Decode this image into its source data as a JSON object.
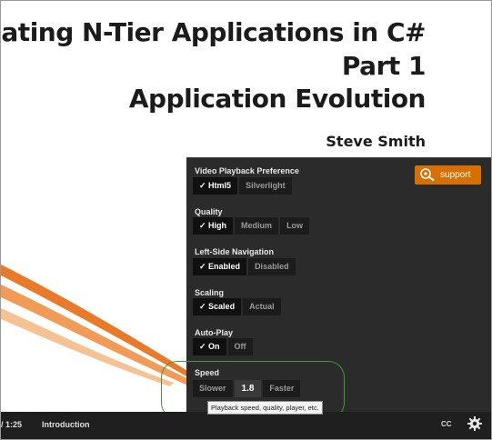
{
  "slide": {
    "title_line1": "Creating N-Tier Applications in C#",
    "title_line2": "Part 1",
    "title_line3": "Application Evolution",
    "author": "Steve Smith"
  },
  "settings_panel": {
    "support_label": "support",
    "sections": [
      {
        "label": "Video Playback Preference",
        "options": [
          "Html5",
          "Silverlight"
        ],
        "selected": "Html5"
      },
      {
        "label": "Quality",
        "options": [
          "High",
          "Medium",
          "Low"
        ],
        "selected": "High"
      },
      {
        "label": "Left-Side Navigation",
        "options": [
          "Enabled",
          "Disabled"
        ],
        "selected": "Enabled"
      },
      {
        "label": "Scaling",
        "options": [
          "Scaled",
          "Actual"
        ],
        "selected": "Scaled"
      },
      {
        "label": "Auto-Play",
        "options": [
          "On",
          "Off"
        ],
        "selected": "On"
      }
    ],
    "speed": {
      "label": "Speed",
      "slower": "Slower",
      "value": "1.8",
      "faster": "Faster"
    },
    "tooltip": "Playback speed, quality, player, etc."
  },
  "player_bar": {
    "time": "/ 1:25",
    "module": "Introduction",
    "cc_label": "CC"
  },
  "colors": {
    "panel_bg": "#2b2b2b",
    "support_orange": "#d96f00",
    "highlight_circle": "#3f9b32",
    "swoosh": "#e8731f"
  },
  "icons": {
    "support": "support-icon",
    "settings": "gear-icon"
  }
}
